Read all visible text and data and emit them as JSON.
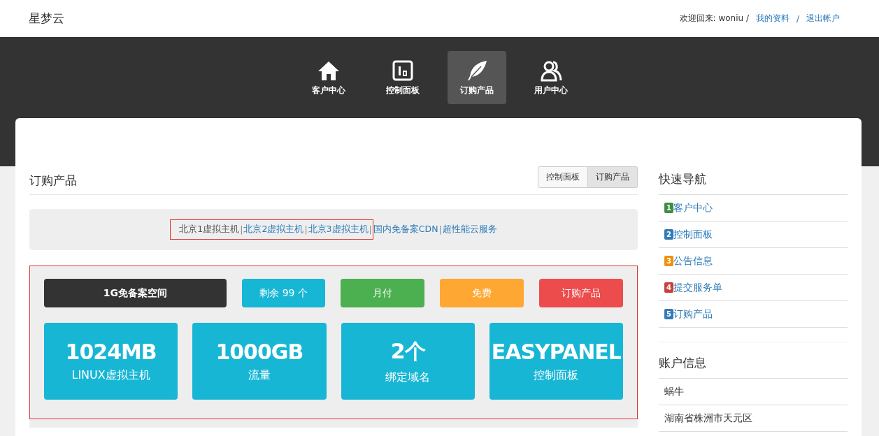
{
  "header": {
    "brand": "星梦云",
    "welcome": "欢迎回来: woniu /",
    "links": [
      {
        "label": "我的资料",
        "sep": "/"
      },
      {
        "label": "退出帐户"
      }
    ]
  },
  "nav": [
    {
      "label": "客户中心",
      "kind": "home",
      "selected": false
    },
    {
      "label": "控制面板",
      "kind": "panel",
      "selected": false
    },
    {
      "label": "订购产品",
      "kind": "products",
      "selected": true
    },
    {
      "label": "用户中心",
      "kind": "users",
      "selected": false
    }
  ],
  "main": {
    "title": "订购产品",
    "segments": [
      {
        "label": "控制面板",
        "selected": false
      },
      {
        "label": "订购产品",
        "selected": true
      }
    ],
    "product_links": [
      {
        "label": "北京1虚拟主机",
        "selected": true
      },
      {
        "label": "北京2虚拟主机",
        "sep": "|",
        "selected": false
      },
      {
        "label": "北京3虚拟主机",
        "sep": "|",
        "selected": false
      },
      {
        "label": "国内免备案CDN",
        "sep": "|",
        "selected": false
      },
      {
        "label": "超性能云服务",
        "sep": "|",
        "selected": false
      }
    ],
    "product_bar": [
      {
        "label": "1G免备案空间",
        "kind": "name",
        "color": "#333333"
      },
      {
        "label": "剩余 99 个",
        "kind": "tag",
        "color": "#17b6d5"
      },
      {
        "label": "月付",
        "kind": "tag",
        "color": "#4caf50"
      },
      {
        "label": "免费",
        "kind": "tag",
        "color": "#ffa733"
      },
      {
        "label": "订购产品",
        "kind": "action",
        "color": "#ec4c4c"
      }
    ],
    "tiles": [
      {
        "value": "1024MB",
        "label": "LINUX虚拟主机"
      },
      {
        "value": "1000GB",
        "label": "流量"
      },
      {
        "value": "2个",
        "label": "绑定域名"
      },
      {
        "value": "EASYPANEL",
        "label": "控制面板"
      }
    ]
  },
  "sidebar": {
    "quick_nav": {
      "title": "快速导航",
      "items": [
        {
          "number": "1",
          "label": "客户中心",
          "color": "#3e8e41"
        },
        {
          "number": "2",
          "label": "控制面板",
          "color": "#337ab7"
        },
        {
          "number": "3",
          "label": "公告信息",
          "color": "#f0900c"
        },
        {
          "number": "4",
          "label": "提交服务单",
          "color": "#c9403c"
        },
        {
          "number": "5",
          "label": "订购产品",
          "color": "#337ab7"
        }
      ]
    },
    "account": {
      "title": "账户信息",
      "items": [
        "蜗牛",
        "湖南省株洲市天元区"
      ]
    }
  }
}
